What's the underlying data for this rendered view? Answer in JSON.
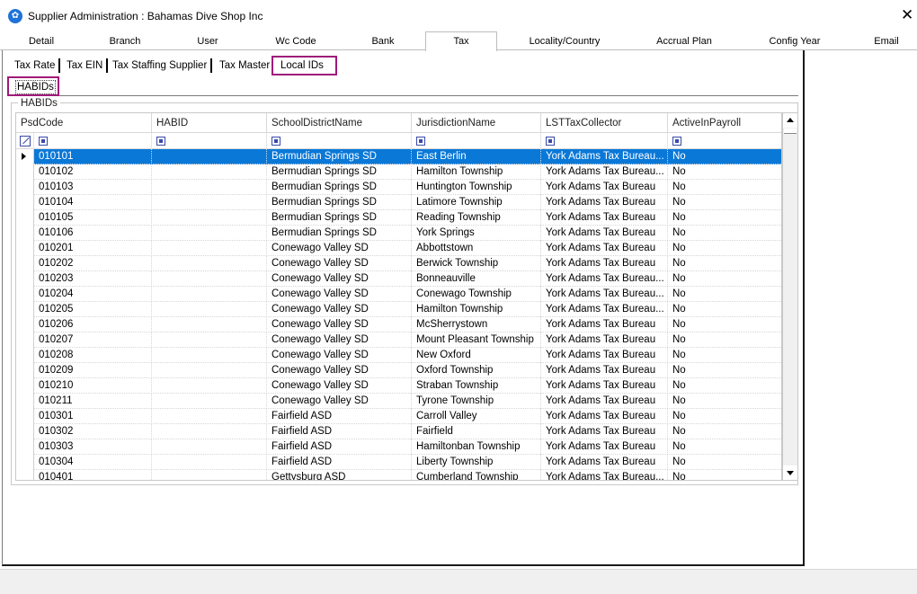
{
  "window": {
    "title": "Supplier Administration : Bahamas Dive Shop Inc",
    "app_icon": "app-logo-icon",
    "close": "✕"
  },
  "main_tabs": [
    {
      "label": "Detail"
    },
    {
      "label": "Branch"
    },
    {
      "label": "User"
    },
    {
      "label": "Wc Code"
    },
    {
      "label": "Bank"
    },
    {
      "label": "Tax"
    },
    {
      "label": "Locality/Country"
    },
    {
      "label": "Accrual Plan"
    },
    {
      "label": "Config Year"
    },
    {
      "label": "Email"
    }
  ],
  "active_main_tab": "Tax",
  "sub_tabs": [
    {
      "label": "Tax Rate"
    },
    {
      "label": "Tax EIN"
    },
    {
      "label": "Tax Staffing Supplier"
    },
    {
      "label": "Tax Master"
    },
    {
      "label": "Local IDs"
    }
  ],
  "active_sub_tab": "Local IDs",
  "inner_tab": {
    "label": "HABIDs"
  },
  "group": {
    "label": "HABIDs"
  },
  "grid": {
    "columns": [
      "PsdCode",
      "HABID",
      "SchoolDistrictName",
      "JurisdictionName",
      "LSTTaxCollector",
      "ActiveInPayroll"
    ],
    "rows": [
      [
        "010101",
        "",
        "Bermudian Springs SD",
        "East Berlin",
        "York Adams Tax Bureau...",
        "No"
      ],
      [
        "010102",
        "",
        "Bermudian Springs SD",
        "Hamilton Township",
        "York Adams Tax Bureau...",
        "No"
      ],
      [
        "010103",
        "",
        "Bermudian Springs SD",
        "Huntington Township",
        "York Adams Tax Bureau",
        "No"
      ],
      [
        "010104",
        "",
        "Bermudian Springs SD",
        "Latimore Township",
        "York Adams Tax Bureau",
        "No"
      ],
      [
        "010105",
        "",
        "Bermudian Springs SD",
        "Reading Township",
        "York Adams Tax Bureau",
        "No"
      ],
      [
        "010106",
        "",
        "Bermudian Springs SD",
        "York Springs",
        "York Adams Tax Bureau",
        "No"
      ],
      [
        "010201",
        "",
        "Conewago Valley SD",
        "Abbottstown",
        "York Adams Tax Bureau",
        "No"
      ],
      [
        "010202",
        "",
        "Conewago Valley SD",
        "Berwick Township",
        "York Adams Tax Bureau",
        "No"
      ],
      [
        "010203",
        "",
        "Conewago Valley SD",
        "Bonneauville",
        "York Adams Tax Bureau...",
        "No"
      ],
      [
        "010204",
        "",
        "Conewago Valley SD",
        "Conewago Township",
        "York Adams Tax Bureau...",
        "No"
      ],
      [
        "010205",
        "",
        "Conewago Valley SD",
        "Hamilton Township",
        "York Adams Tax Bureau...",
        "No"
      ],
      [
        "010206",
        "",
        "Conewago Valley SD",
        "McSherrystown",
        "York Adams Tax Bureau",
        "No"
      ],
      [
        "010207",
        "",
        "Conewago Valley SD",
        "Mount Pleasant Township",
        "York Adams Tax Bureau",
        "No"
      ],
      [
        "010208",
        "",
        "Conewago Valley SD",
        "New Oxford",
        "York Adams Tax Bureau",
        "No"
      ],
      [
        "010209",
        "",
        "Conewago Valley SD",
        "Oxford Township",
        "York Adams Tax Bureau",
        "No"
      ],
      [
        "010210",
        "",
        "Conewago Valley SD",
        "Straban Township",
        "York Adams Tax Bureau",
        "No"
      ],
      [
        "010211",
        "",
        "Conewago Valley SD",
        "Tyrone Township",
        "York Adams Tax Bureau",
        "No"
      ],
      [
        "010301",
        "",
        "Fairfield ASD",
        "Carroll Valley",
        "York Adams Tax Bureau",
        "No"
      ],
      [
        "010302",
        "",
        "Fairfield ASD",
        "Fairfield",
        "York Adams Tax Bureau",
        "No"
      ],
      [
        "010303",
        "",
        "Fairfield ASD",
        "Hamiltonban Township",
        "York Adams Tax Bureau",
        "No"
      ],
      [
        "010304",
        "",
        "Fairfield ASD",
        "Liberty Township",
        "York Adams Tax Bureau",
        "No"
      ],
      [
        "010401",
        "",
        "Gettysburg ASD",
        "Cumberland Township",
        "York Adams Tax Bureau...",
        "No"
      ]
    ],
    "selected_row": 0
  },
  "colors": {
    "selection": "#0a78d7",
    "highlight_border": "#a0197a"
  }
}
